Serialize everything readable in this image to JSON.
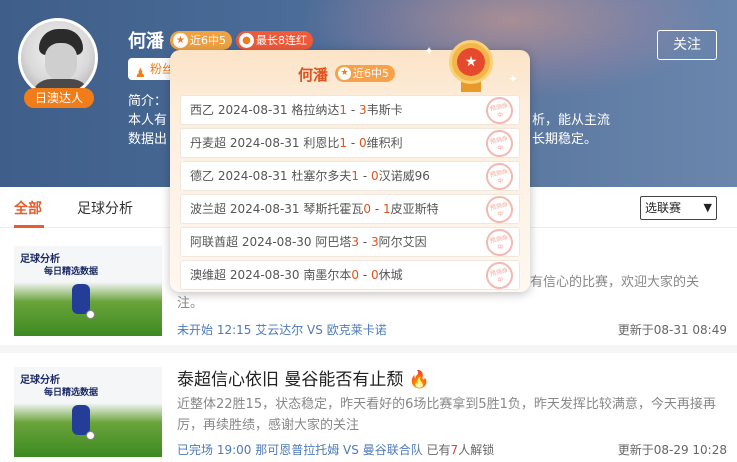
{
  "profile": {
    "name": "何潘",
    "expert_tag": "日澳达人",
    "badge_recent": "近6中5",
    "badge_streak": "最长8连红",
    "fans_label": "粉丝",
    "follow_label": "关注",
    "intro_label": "简介：",
    "intro_line1": "本人有",
    "intro_line2": "数据出",
    "intro_right1": "析，能从主流",
    "intro_right2": "长期稳定。"
  },
  "tabs": {
    "all": "全部",
    "football": "足球分析",
    "select_value": "选联赛"
  },
  "popup": {
    "name": "何潘",
    "badge": "近6中5",
    "stamp_text": "预测命中",
    "rows": [
      {
        "league": "西乙",
        "date": "2024-08-31",
        "home": "格拉纳达",
        "hs": "1",
        "as": "3",
        "away": "韦斯卡"
      },
      {
        "league": "丹麦超",
        "date": "2024-08-31",
        "home": "利恩比",
        "hs": "1",
        "as": "0",
        "away": "维积利"
      },
      {
        "league": "德乙",
        "date": "2024-08-31",
        "home": "杜塞尔多夫",
        "hs": "1",
        "as": "0",
        "away": "汉诺威96"
      },
      {
        "league": "波兰超",
        "date": "2024-08-31",
        "home": "琴斯托霍瓦",
        "hs": "0",
        "as": "1",
        "away": "皮亚斯特"
      },
      {
        "league": "阿联酋超",
        "date": "2024-08-30",
        "home": "阿巴塔",
        "hs": "3",
        "as": "3",
        "away": "阿尔艾因"
      },
      {
        "league": "澳维超",
        "date": "2024-08-30",
        "home": "南墨尔本",
        "hs": "0",
        "as": "0",
        "away": "休城"
      }
    ]
  },
  "articles": [
    {
      "thumb_title": "足球分析",
      "thumb_sub": "每日精选数据",
      "desc_line1": "有信心的比赛，欢迎大家的关",
      "desc_line2": "注。",
      "status": "未开始 12:15",
      "match": "艾云达尔 VS 欧克莱卡诺",
      "updated": "更新于08-31 08:49"
    },
    {
      "thumb_title": "足球分析",
      "thumb_sub": "每日精选数据",
      "title": "泰超信心依旧 曼谷能否有止颓",
      "desc": "近整体22胜15，状态稳定，昨天看好的6场比赛拿到5胜1负，昨天发挥比较满意，今天再接再厉，再续胜绩，感谢大家的关注",
      "status": "已完场 19:00",
      "match": "那可恩普拉托姆 VS 曼谷联合队",
      "unlock_prefix": "已有",
      "unlock_count": "7",
      "unlock_suffix": "人解锁",
      "updated": "更新于08-29 10:28"
    }
  ]
}
